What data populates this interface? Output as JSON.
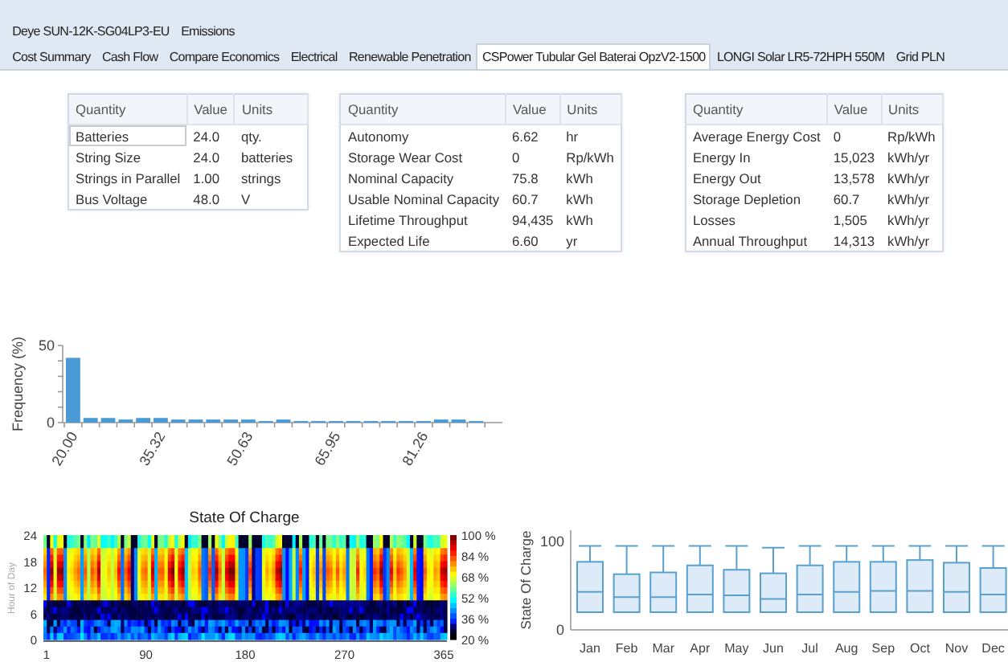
{
  "top_tabs": [
    {
      "label": "Deye SUN-12K-SG04LP3-EU",
      "selected": false
    },
    {
      "label": "Emissions",
      "selected": false
    }
  ],
  "tabs": [
    {
      "label": "Cost Summary",
      "selected": false
    },
    {
      "label": "Cash Flow",
      "selected": false
    },
    {
      "label": "Compare Economics",
      "selected": false
    },
    {
      "label": "Electrical",
      "selected": false
    },
    {
      "label": "Renewable Penetration",
      "selected": false
    },
    {
      "label": "CSPower Tubular Gel Baterai OpzV2-1500",
      "selected": true
    },
    {
      "label": "LONGI Solar LR5-72HPH 550M",
      "selected": false
    },
    {
      "label": "Grid PLN",
      "selected": false
    }
  ],
  "tables": [
    {
      "columns": [
        "Quantity",
        "Value",
        "Units"
      ],
      "rows": [
        {
          "cells": [
            "Batteries",
            "24.0",
            "qty."
          ],
          "selected": true
        },
        {
          "cells": [
            "String Size",
            "24.0",
            "batteries"
          ],
          "selected": false
        },
        {
          "cells": [
            "Strings in Parallel",
            "1.00",
            "strings"
          ],
          "selected": false
        },
        {
          "cells": [
            "Bus Voltage",
            "48.0",
            "V"
          ],
          "selected": false
        }
      ]
    },
    {
      "columns": [
        "Quantity",
        "Value",
        "Units"
      ],
      "rows": [
        {
          "cells": [
            "Autonomy",
            "6.62",
            "hr"
          ]
        },
        {
          "cells": [
            "Storage Wear Cost",
            "0",
            "Rp/kWh"
          ]
        },
        {
          "cells": [
            "Nominal Capacity",
            "75.8",
            "kWh"
          ]
        },
        {
          "cells": [
            "Usable Nominal Capacity",
            "60.7",
            "kWh"
          ]
        },
        {
          "cells": [
            "Lifetime Throughput",
            "94,435",
            "kWh"
          ]
        },
        {
          "cells": [
            "Expected Life",
            "6.60",
            "yr"
          ]
        }
      ]
    },
    {
      "columns": [
        "Quantity",
        "Value",
        "Units"
      ],
      "rows": [
        {
          "cells": [
            "Average Energy Cost",
            "0",
            "Rp/kWh"
          ]
        },
        {
          "cells": [
            "Energy In",
            "15,023",
            "kWh/yr"
          ]
        },
        {
          "cells": [
            "Energy Out",
            "13,578",
            "kWh/yr"
          ]
        },
        {
          "cells": [
            "Storage Depletion",
            "60.7",
            "kWh/yr"
          ]
        },
        {
          "cells": [
            "Losses",
            "1,505",
            "kWh/yr"
          ]
        },
        {
          "cells": [
            "Annual Throughput",
            "14,313",
            "kWh/yr"
          ]
        }
      ]
    }
  ],
  "histogram": {
    "chart_data": {
      "type": "bar",
      "ylabel": "Frequency (%)",
      "ylim": [
        0,
        50
      ],
      "yticks": [
        0,
        50
      ],
      "values": [
        42,
        3,
        3,
        2,
        3,
        3,
        2,
        2,
        2,
        2,
        2,
        1,
        2,
        1,
        1,
        1,
        1,
        1,
        1,
        1,
        1,
        2,
        2,
        1,
        0
      ]
    },
    "x_tick_labels": [
      "20.00",
      "35.32",
      "50.63",
      "65.95",
      "81.26"
    ]
  },
  "heatmap": {
    "title": "State Of Charge",
    "ylabel": "Hour of Day",
    "yticks": [
      "24",
      "18",
      "12",
      "6",
      "0"
    ],
    "xticks": [
      "1",
      "90",
      "180",
      "270",
      "365"
    ],
    "colorbar": [
      "100 %",
      "84 %",
      "68 %",
      "52 %",
      "36 %",
      "20 %"
    ]
  },
  "boxplot": {
    "ylabel": "State Of Charge",
    "yticks": [
      "100",
      "0"
    ],
    "months": [
      "Jan",
      "Feb",
      "Mar",
      "Apr",
      "May",
      "Jun",
      "Jul",
      "Aug",
      "Sep",
      "Oct",
      "Nov",
      "Dec"
    ]
  }
}
